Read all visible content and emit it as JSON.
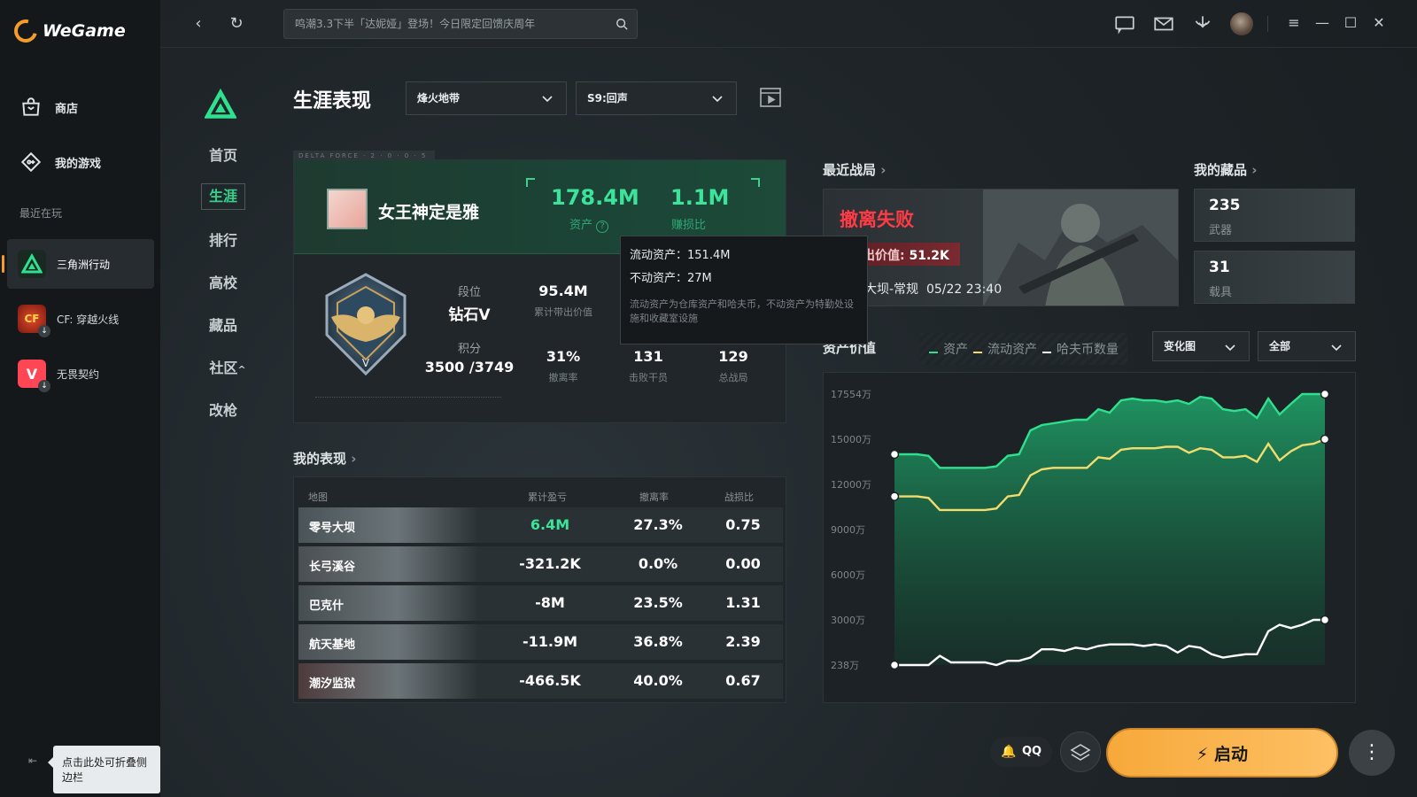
{
  "app": {
    "name": "WeGame"
  },
  "sidebar": {
    "store_label": "商店",
    "mygames_label": "我的游戏",
    "recent_label": "最近在玩",
    "games": [
      {
        "name": "三角洲行动"
      },
      {
        "name": "CF: 穿越火线"
      },
      {
        "name": "无畏契约"
      }
    ],
    "collapse_tip": "点击此处可折叠侧边栏"
  },
  "topbar": {
    "search_value": "鸣潮3.3下半「达妮娅」登场！今日限定回馈庆周年"
  },
  "game_nav": {
    "items": [
      "首页",
      "生涯",
      "排行",
      "高校",
      "藏品",
      "社区",
      "改枪"
    ],
    "active": "生涯",
    "community_caret": "^"
  },
  "career": {
    "title": "生涯表现",
    "mode_dropdown": "烽火地带",
    "season_dropdown": "S9:回声",
    "card_tag": "DELTA FORCE · 2 · 0 · 0 · 5",
    "player_name": "女王神定是雅",
    "assets_value": "178.4M",
    "assets_label": "资产",
    "kd_value": "1.1M",
    "kd_label": "赚损比",
    "rank_label": "段位",
    "rank_value": "钻石V",
    "score_label": "积分",
    "score_value": "3500 /3749",
    "metrics": [
      {
        "value": "95.4M",
        "label": "累计带出价值"
      },
      {
        "value": "31%",
        "label": "撤离率"
      },
      {
        "value": "131",
        "label": "击败干员"
      },
      {
        "value": "129",
        "label": "总战局"
      }
    ]
  },
  "asset_tooltip": {
    "liquid": "流动资产：151.4M",
    "fixed": "不动资产：27M",
    "note": "流动资产为仓库资产和哈夫币，不动资产为特勤处设施和收藏室设施"
  },
  "performance": {
    "title": "我的表现",
    "headers": [
      "地图",
      "累计盈亏",
      "撤离率",
      "战损比"
    ],
    "rows": [
      {
        "map": "零号大坝",
        "profit": "6.4M",
        "rate": "27.3%",
        "kd": "0.75",
        "positive": true
      },
      {
        "map": "长弓溪谷",
        "profit": "-321.2K",
        "rate": "0.0%",
        "kd": "0.00",
        "positive": false
      },
      {
        "map": "巴克什",
        "profit": "-8M",
        "rate": "23.5%",
        "kd": "1.31",
        "positive": false
      },
      {
        "map": "航天基地",
        "profit": "-11.9M",
        "rate": "36.8%",
        "kd": "2.39",
        "positive": false
      },
      {
        "map": "潮汐监狱",
        "profit": "-466.5K",
        "rate": "40.0%",
        "kd": "0.67",
        "positive": false
      }
    ]
  },
  "recent_match": {
    "title": "最近战局",
    "result": "撤离失败",
    "value_label": "带出价值:",
    "value": "51.2K",
    "map_mode": "零号大坝-常规",
    "time": "05/22 23:40"
  },
  "collection": {
    "title": "我的藏品",
    "items": [
      {
        "count": "235",
        "label": "武器"
      },
      {
        "count": "31",
        "label": "载具"
      }
    ]
  },
  "asset_chart": {
    "title": "资产价值",
    "legend": [
      "资产",
      "流动资产",
      "哈夫币数量"
    ],
    "view_dropdown": "变化图",
    "range_dropdown": "全部"
  },
  "chart_data": {
    "type": "area",
    "yticks": [
      "238万",
      "3000万",
      "6000万",
      "9000万",
      "12000万",
      "15000万",
      "17554万"
    ],
    "ytick_values": [
      238,
      3000,
      6000,
      9000,
      12000,
      15000,
      17554
    ],
    "ylim": [
      238,
      17554
    ],
    "series": [
      {
        "name": "资产",
        "color": "#2fe08e",
        "values": [
          14000,
          14000,
          14000,
          13900,
          13100,
          13100,
          13100,
          13100,
          13100,
          13200,
          13900,
          14000,
          15500,
          15800,
          15900,
          16000,
          16100,
          16100,
          16700,
          16500,
          17200,
          17300,
          17200,
          17200,
          17100,
          17200,
          17000,
          17400,
          17300,
          16700,
          16600,
          16700,
          16200,
          17300,
          16400,
          17000,
          17600,
          17700,
          17900
        ]
      },
      {
        "name": "流动资产",
        "color": "#f2dc6e",
        "values": [
          11200,
          11200,
          11200,
          11100,
          10300,
          10300,
          10300,
          10300,
          10300,
          10400,
          11200,
          11300,
          12600,
          13000,
          13100,
          13100,
          13100,
          13100,
          13800,
          13700,
          14300,
          14400,
          14400,
          14400,
          14500,
          14500,
          14100,
          14400,
          14300,
          13800,
          13800,
          13900,
          13500,
          14700,
          13600,
          14200,
          14600,
          14700,
          15000
        ]
      },
      {
        "name": "哈夫币数量",
        "color": "#ffffff",
        "values": [
          238,
          238,
          238,
          238,
          800,
          400,
          400,
          400,
          400,
          200,
          500,
          500,
          700,
          1200,
          1200,
          1100,
          1300,
          1200,
          1400,
          1500,
          1500,
          1500,
          1400,
          1500,
          1400,
          1000,
          1400,
          1300,
          900,
          700,
          800,
          900,
          900,
          2300,
          2700,
          2500,
          2700,
          3000,
          3000
        ]
      }
    ]
  },
  "bottom": {
    "qq_label": "QQ",
    "launch_label": "启动",
    "more_label": "⋮"
  },
  "colors": {
    "accent": "#f39c2c",
    "green": "#3de39a",
    "danger": "#ff3b46"
  }
}
